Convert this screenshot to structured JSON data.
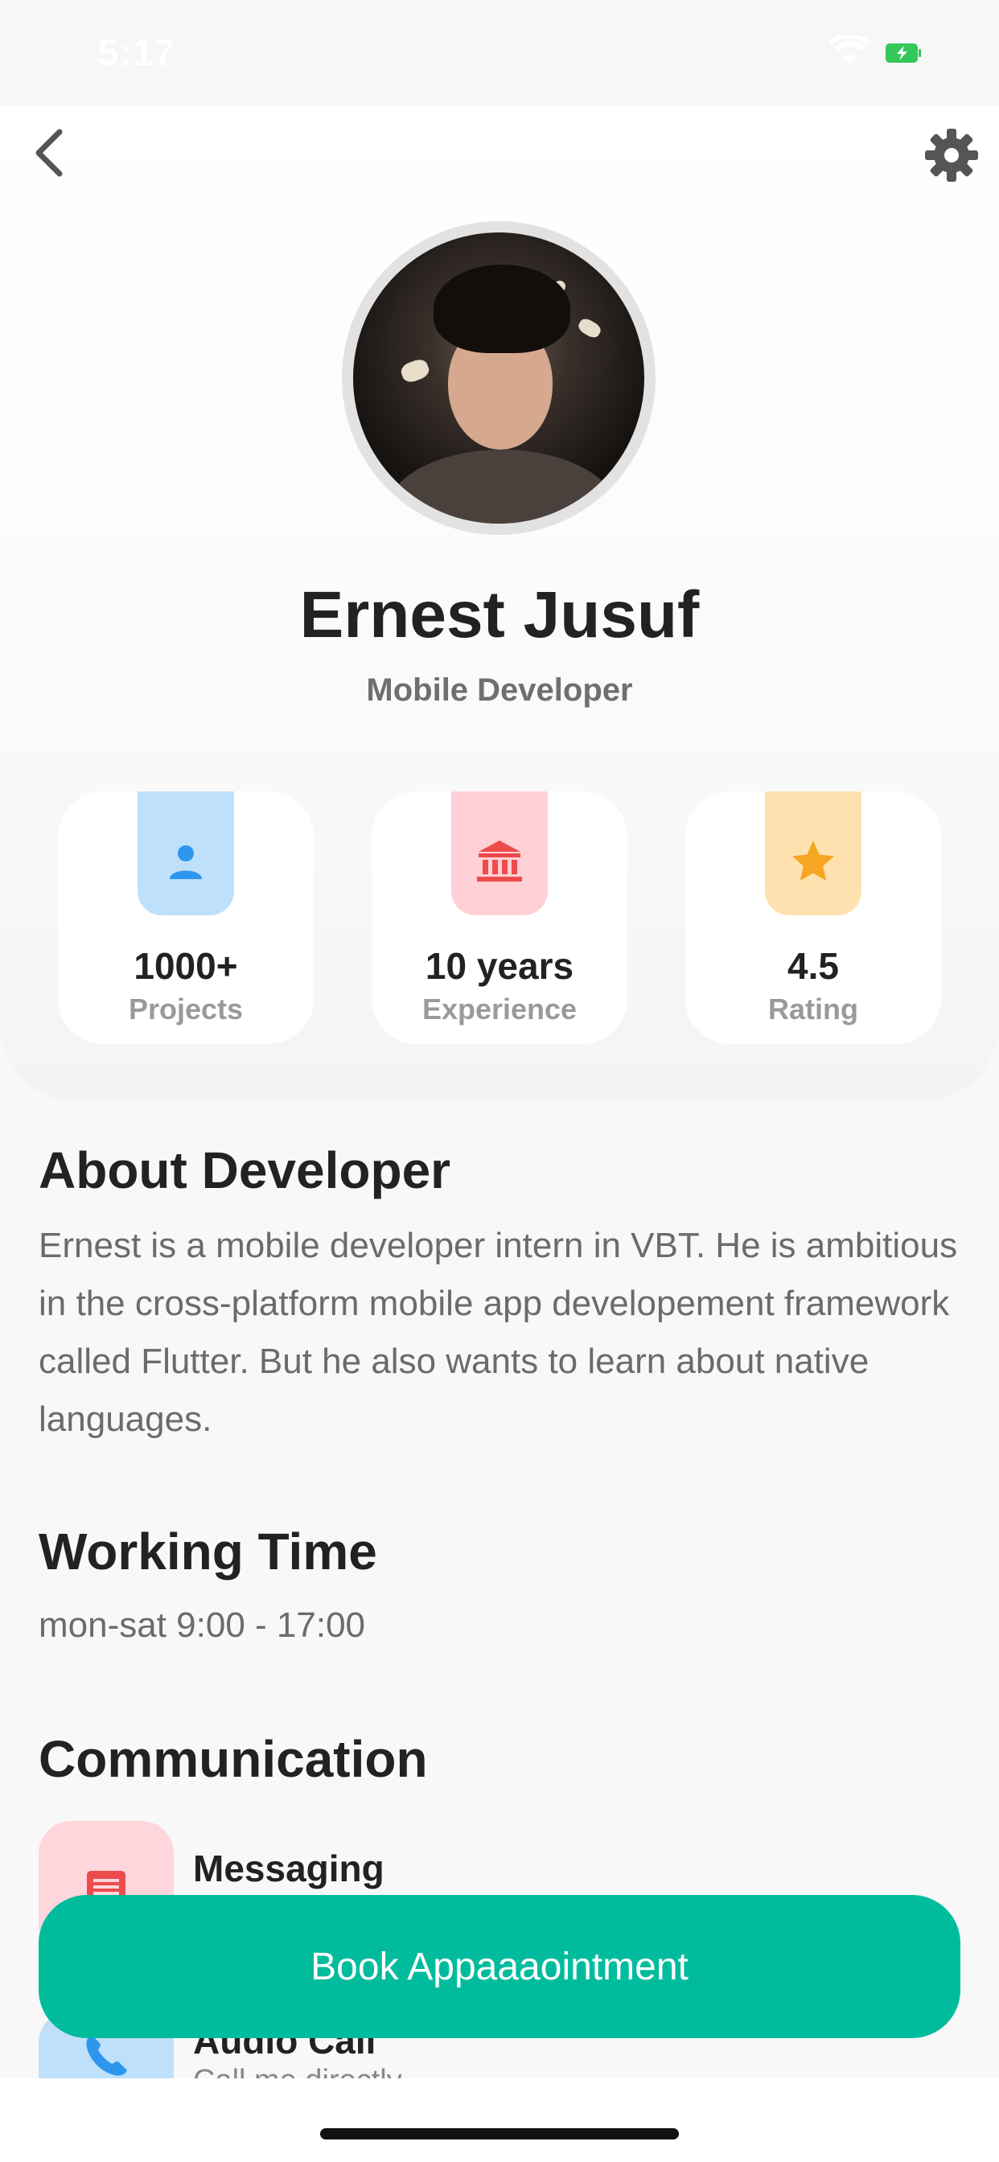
{
  "status_bar": {
    "time": "5:17"
  },
  "profile": {
    "name": "Ernest Jusuf",
    "role": "Mobile Developer"
  },
  "stats": [
    {
      "value": "1000+",
      "label": "Projects",
      "icon": "person-icon",
      "tab_color": "#bfe0fb",
      "icon_color": "#2f96ee"
    },
    {
      "value": "10 years",
      "label": "Experience",
      "icon": "bank-icon",
      "tab_color": "#ffd0d6",
      "icon_color": "#ef4b4b"
    },
    {
      "value": "4.5",
      "label": "Rating",
      "icon": "star-icon",
      "tab_color": "#ffe1b0",
      "icon_color": "#f6a623"
    }
  ],
  "about": {
    "title": "About Developer",
    "text": "Ernest is a mobile developer intern in VBT. He is ambitious in the cross-platform mobile app developement framework called Flutter. But he also wants to learn about native languages."
  },
  "working_time": {
    "title": "Working Time",
    "text": "mon-sat 9:00 - 17:00"
  },
  "communication": {
    "title": "Communication",
    "items": [
      {
        "title": "Messaging",
        "subtitle": "",
        "icon": "message-icon",
        "bg": "#ffd6dc",
        "icon_color": "#ec4c4c"
      },
      {
        "title": "Audio Call",
        "subtitle": "Call me directly",
        "icon": "phone-icon",
        "bg": "#bfe0fb",
        "icon_color": "#2f96ee"
      }
    ]
  },
  "book_button": {
    "label": "Book Appaaaointment",
    "color": "#00bc9d"
  }
}
